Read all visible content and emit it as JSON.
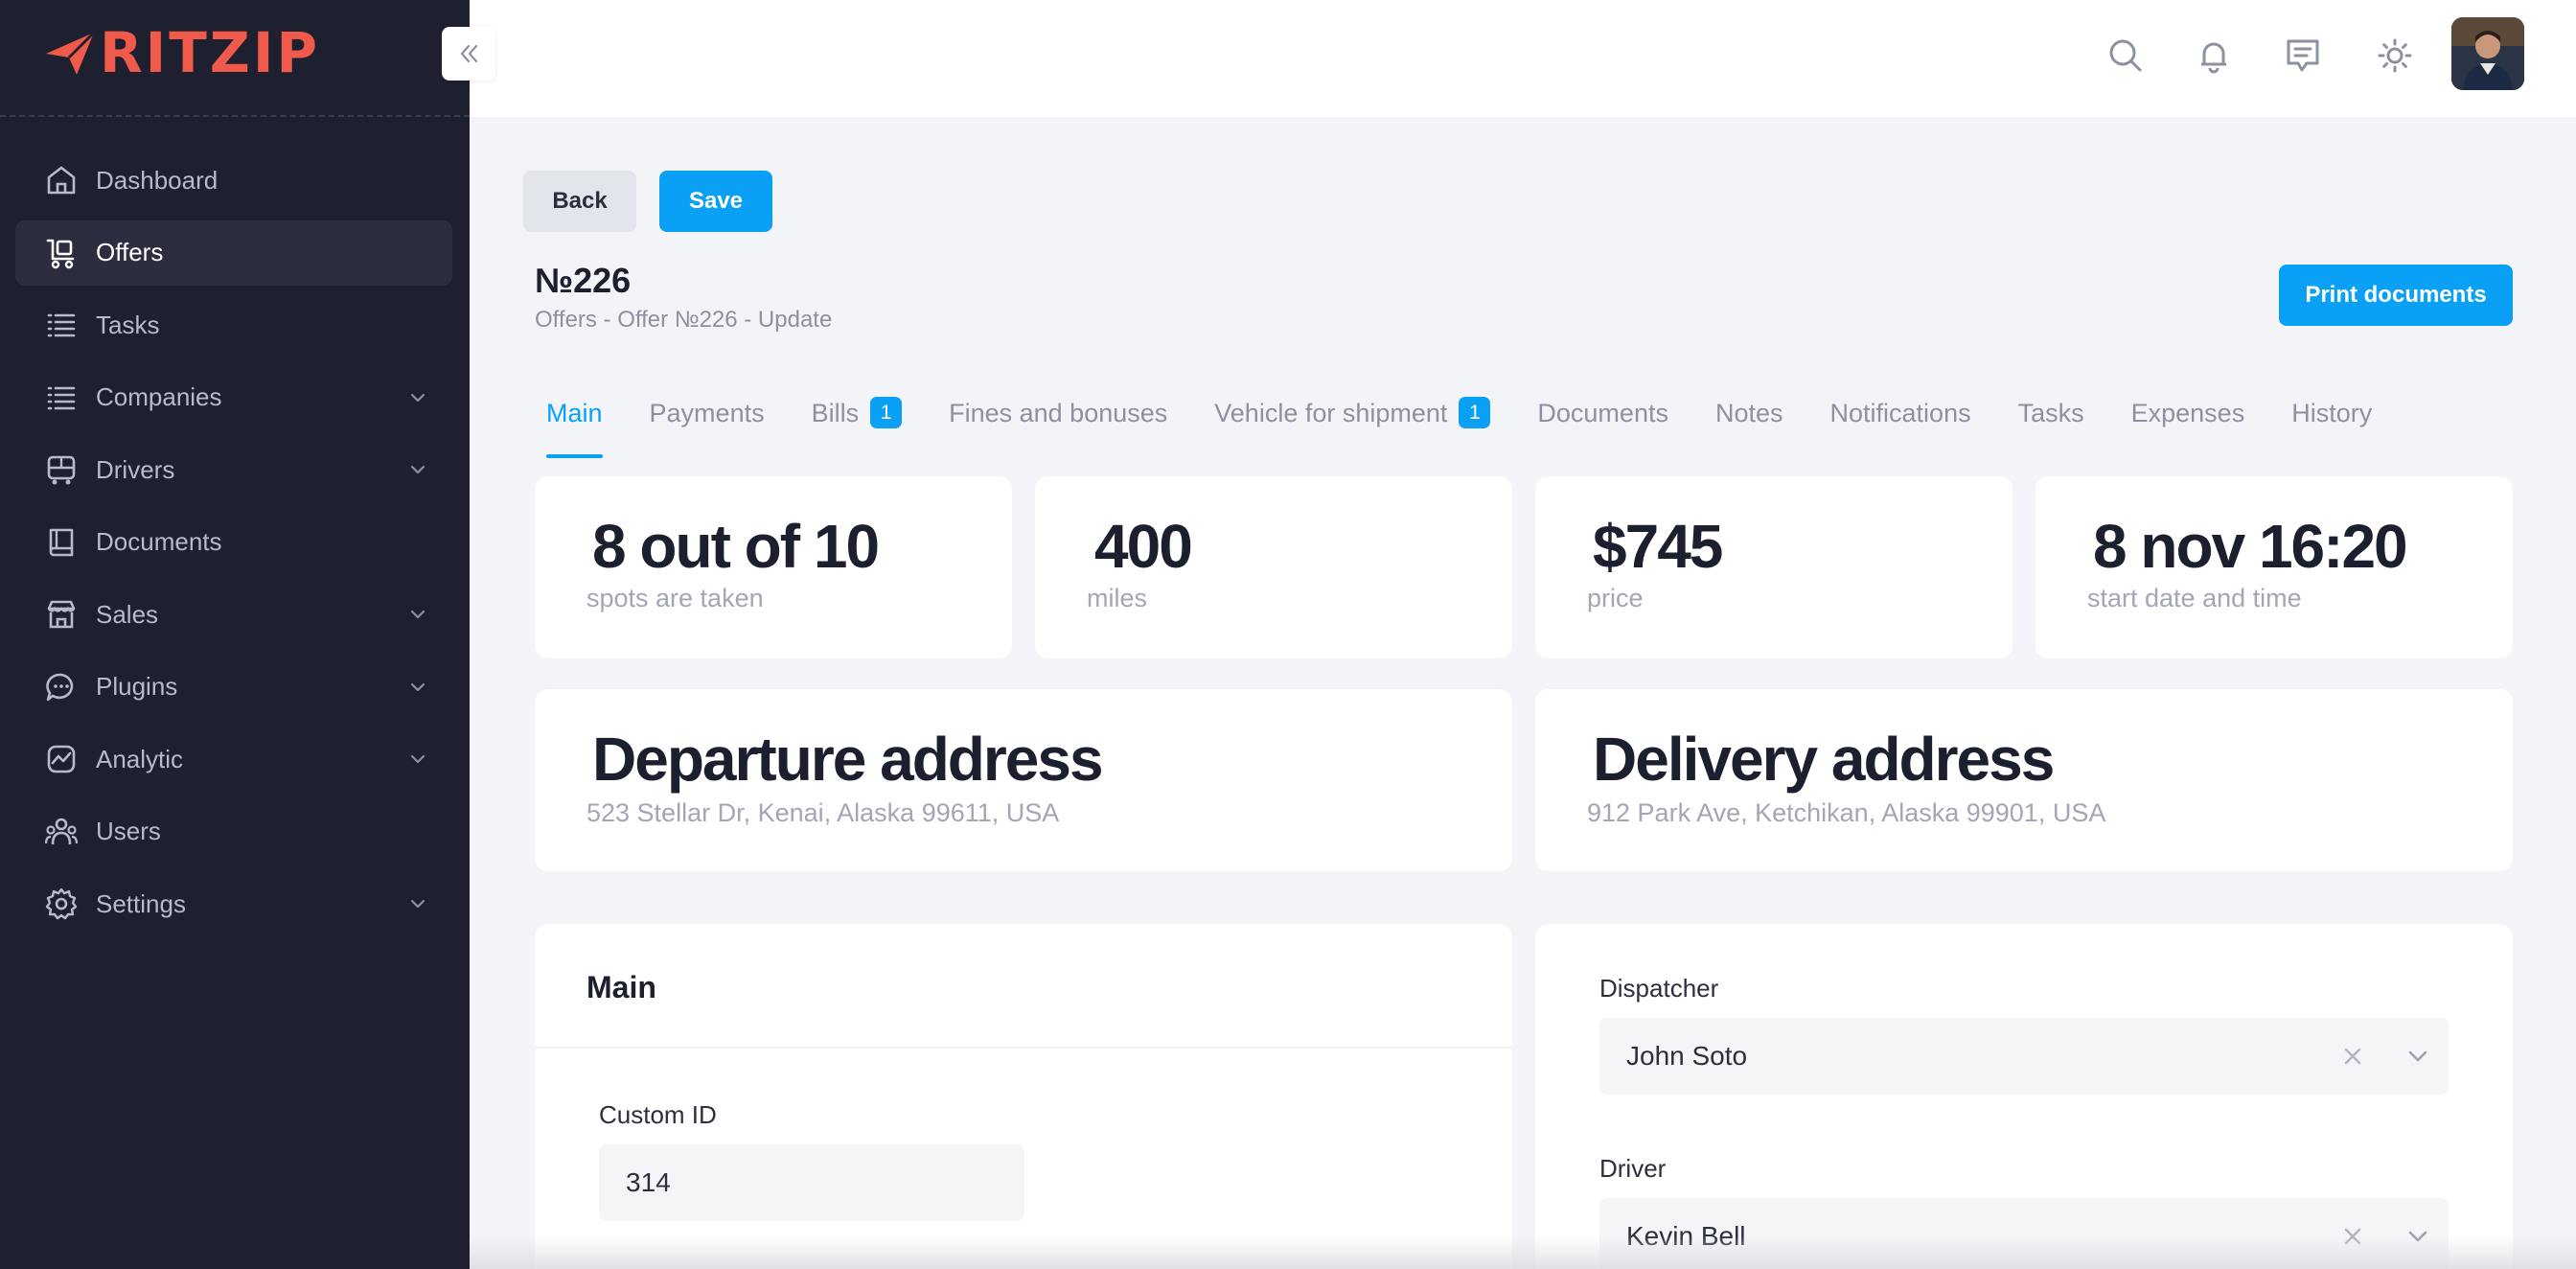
{
  "app": {
    "logo_text": "RITZIP"
  },
  "sidebar": {
    "items": [
      {
        "label": "Dashboard",
        "icon": "home-icon",
        "has_chevron": false,
        "active": false
      },
      {
        "label": "Offers",
        "icon": "cart-icon",
        "has_chevron": false,
        "active": true
      },
      {
        "label": "Tasks",
        "icon": "list-icon",
        "has_chevron": false,
        "active": false
      },
      {
        "label": "Companies",
        "icon": "list-icon",
        "has_chevron": true,
        "active": false
      },
      {
        "label": "Drivers",
        "icon": "bus-icon",
        "has_chevron": true,
        "active": false
      },
      {
        "label": "Documents",
        "icon": "book-icon",
        "has_chevron": false,
        "active": false
      },
      {
        "label": "Sales",
        "icon": "store-icon",
        "has_chevron": true,
        "active": false
      },
      {
        "label": "Plugins",
        "icon": "chat-icon",
        "has_chevron": true,
        "active": false
      },
      {
        "label": "Analytic",
        "icon": "chart-icon",
        "has_chevron": true,
        "active": false
      },
      {
        "label": "Users",
        "icon": "users-icon",
        "has_chevron": false,
        "active": false
      },
      {
        "label": "Settings",
        "icon": "gear-icon",
        "has_chevron": true,
        "active": false
      }
    ]
  },
  "header": {
    "icons": [
      "search-icon",
      "bell-icon",
      "message-icon",
      "sun-icon"
    ]
  },
  "toolbar": {
    "back_label": "Back",
    "save_label": "Save",
    "print_label": "Print documents"
  },
  "page": {
    "title": "№226",
    "breadcrumb": "Offers - Offer №226 - Update"
  },
  "tabs": [
    {
      "label": "Main",
      "active": true
    },
    {
      "label": "Payments"
    },
    {
      "label": "Bills",
      "badge": "1"
    },
    {
      "label": "Fines and bonuses"
    },
    {
      "label": "Vehicle for shipment",
      "badge": "1"
    },
    {
      "label": "Documents"
    },
    {
      "label": "Notes"
    },
    {
      "label": "Notifications"
    },
    {
      "label": "Tasks"
    },
    {
      "label": "Expenses"
    },
    {
      "label": "History"
    }
  ],
  "stats": [
    {
      "value": "8 out of 10",
      "label": "spots are taken"
    },
    {
      "value": "400",
      "label": "miles"
    },
    {
      "value": "$745",
      "label": "price"
    },
    {
      "value": "8 nov 16:20",
      "label": "start date and time"
    }
  ],
  "addresses": {
    "departure": {
      "title": "Departure address",
      "text": "523 Stellar Dr, Kenai, Alaska 99611, USA"
    },
    "delivery": {
      "title": "Delivery address",
      "text": "912 Park Ave, Ketchikan, Alaska 99901, USA"
    }
  },
  "main_section": {
    "title": "Main",
    "custom_id_label": "Custom ID",
    "custom_id_value": "314"
  },
  "assignment": {
    "dispatcher_label": "Dispatcher",
    "dispatcher_value": "John Soto",
    "driver_label": "Driver",
    "driver_value": "Kevin Bell"
  },
  "colors": {
    "accent": "#0aa0f5",
    "logo": "#f05a4a",
    "sidebar": "#1e2030"
  }
}
